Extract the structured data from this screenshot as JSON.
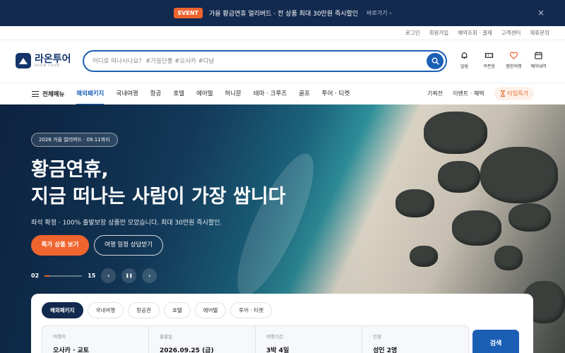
{
  "promo": {
    "badge": "EVENT",
    "text": "가을 황금연휴 얼리버드 · 전 상품 최대 30만원 즉시할인",
    "link": "바로가기 ›",
    "close": "×"
  },
  "util_links": [
    "로그인",
    "회원가입",
    "예약조회 · 결제",
    "고객센터",
    "제휴문의"
  ],
  "logo": {
    "name": "라온투어",
    "sub": "RAON TOUR"
  },
  "search": {
    "placeholder": "어디로 떠나시나요?  #가을단풍 #오사카 #다낭"
  },
  "header_icons": [
    {
      "icon": "bell-icon",
      "label": "알림"
    },
    {
      "icon": "ticket-icon",
      "label": "쿠폰함"
    },
    {
      "icon": "heart-icon",
      "label": "찜한여행"
    },
    {
      "icon": "calendar-icon",
      "label": "예약내역"
    }
  ],
  "nav": {
    "all_menu": "전체메뉴",
    "items": [
      "해외패키지",
      "국내여행",
      "항공",
      "호텔",
      "에어텔",
      "허니문",
      "테마 · 크루즈",
      "골프",
      "투어 · 티켓"
    ],
    "active_index": 0,
    "right": {
      "plan": "기획전",
      "events": "이벤트 · 혜택",
      "timedeal": "타임특가"
    }
  },
  "hero": {
    "badge": "2026 가을 얼리버드 · 09.11까지",
    "title_line1": "황금연휴,",
    "title_line2": "지금 떠나는 사람이 가장 쌉니다",
    "subtitle": "좌석 확정 · 100% 출발보장 상품만 모았습니다. 최대 30만원 즉시할인.",
    "btn_primary": "특가 상품 보기",
    "btn_secondary": "여행 일정 상담받기",
    "slide_current": "02",
    "slide_total": "15",
    "slide_progress": 0.133,
    "prev": "‹",
    "pause": "❚❚",
    "next": "›"
  },
  "search_panel": {
    "tabs": [
      "해외패키지",
      "국내여행",
      "항공권",
      "호텔",
      "에어텔",
      "투어 · 티켓"
    ],
    "active_tab": 0,
    "fields": [
      {
        "label": "여행지",
        "value": "오사카 · 교토"
      },
      {
        "label": "출발일",
        "value": "2026.09.25 (금)"
      },
      {
        "label": "여행기간",
        "value": "3박 4일"
      },
      {
        "label": "인원",
        "value": "성인 2명"
      }
    ],
    "submit": "검색"
  },
  "colors": {
    "brand": "#14356b",
    "accent": "#f0642e",
    "primary": "#1b5fb5",
    "promo_bg": "#132a4f"
  }
}
